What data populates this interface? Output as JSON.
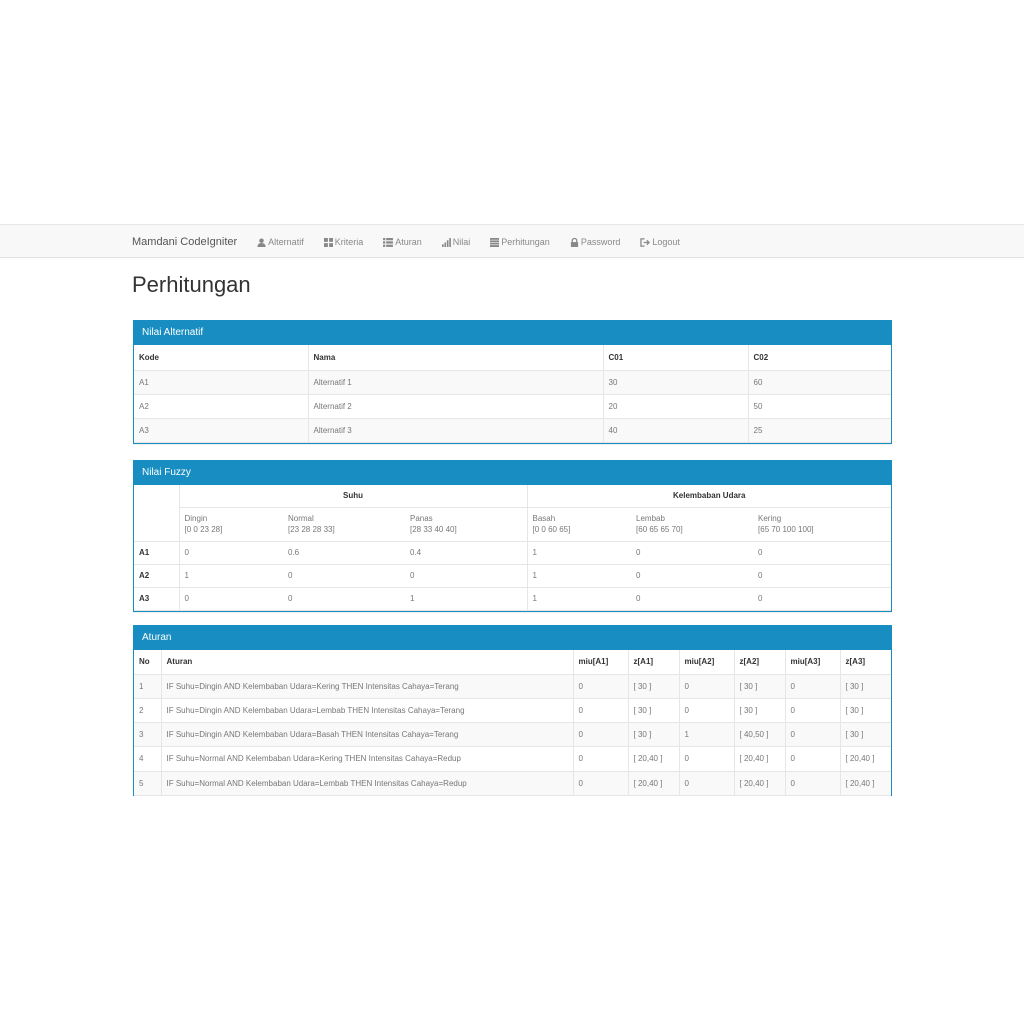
{
  "navbar": {
    "brand": "Mamdani CodeIgniter",
    "items": [
      {
        "label": "Alternatif",
        "icon": "user-icon"
      },
      {
        "label": "Kriteria",
        "icon": "grid-icon"
      },
      {
        "label": "Aturan",
        "icon": "list-icon"
      },
      {
        "label": "Nilai",
        "icon": "signal-icon"
      },
      {
        "label": "Perhitungan",
        "icon": "table-icon"
      },
      {
        "label": "Password",
        "icon": "lock-icon"
      },
      {
        "label": "Logout",
        "icon": "logout-icon"
      }
    ]
  },
  "page": {
    "title": "Perhitungan"
  },
  "nilai_alternatif": {
    "heading": "Nilai Alternatif",
    "columns": [
      "Kode",
      "Nama",
      "C01",
      "C02"
    ],
    "rows": [
      [
        "A1",
        "Alternatif 1",
        "30",
        "60"
      ],
      [
        "A2",
        "Alternatif 2",
        "20",
        "50"
      ],
      [
        "A3",
        "Alternatif 3",
        "40",
        "25"
      ]
    ]
  },
  "nilai_fuzzy": {
    "heading": "Nilai Fuzzy",
    "groups": [
      "Suhu",
      "Kelembaban Udara"
    ],
    "sets": [
      {
        "name": "Dingin",
        "range": "[0 0 23 28]"
      },
      {
        "name": "Normal",
        "range": "[23 28 28 33]"
      },
      {
        "name": "Panas",
        "range": "[28 33 40 40]"
      },
      {
        "name": "Basah",
        "range": "[0 0 60 65]"
      },
      {
        "name": "Lembab",
        "range": "[60 65 65 70]"
      },
      {
        "name": "Kering",
        "range": "[65 70 100 100]"
      }
    ],
    "rows": [
      {
        "kode": "A1",
        "values": [
          "0",
          "0.6",
          "0.4",
          "1",
          "0",
          "0"
        ]
      },
      {
        "kode": "A2",
        "values": [
          "1",
          "0",
          "0",
          "1",
          "0",
          "0"
        ]
      },
      {
        "kode": "A3",
        "values": [
          "0",
          "0",
          "1",
          "1",
          "0",
          "0"
        ]
      }
    ]
  },
  "aturan": {
    "heading": "Aturan",
    "columns": [
      "No",
      "Aturan",
      "miu[A1]",
      "z[A1]",
      "miu[A2]",
      "z[A2]",
      "miu[A3]",
      "z[A3]"
    ],
    "rows": [
      [
        "1",
        "IF Suhu=Dingin AND Kelembaban Udara=Kering THEN Intensitas Cahaya=Terang",
        "0",
        "[ 30 ]",
        "0",
        "[ 30 ]",
        "0",
        "[ 30 ]"
      ],
      [
        "2",
        "IF Suhu=Dingin AND Kelembaban Udara=Lembab THEN Intensitas Cahaya=Terang",
        "0",
        "[ 30 ]",
        "0",
        "[ 30 ]",
        "0",
        "[ 30 ]"
      ],
      [
        "3",
        "IF Suhu=Dingin AND Kelembaban Udara=Basah THEN Intensitas Cahaya=Terang",
        "0",
        "[ 30 ]",
        "1",
        "[ 40,50 ]",
        "0",
        "[ 30 ]"
      ],
      [
        "4",
        "IF Suhu=Normal AND Kelembaban Udara=Kering THEN Intensitas Cahaya=Redup",
        "0",
        "[ 20,40 ]",
        "0",
        "[ 20,40 ]",
        "0",
        "[ 20,40 ]"
      ],
      [
        "5",
        "IF Suhu=Normal AND Kelembaban Udara=Lembab THEN Intensitas Cahaya=Redup",
        "0",
        "[ 20,40 ]",
        "0",
        "[ 20,40 ]",
        "0",
        "[ 20,40 ]"
      ]
    ]
  }
}
